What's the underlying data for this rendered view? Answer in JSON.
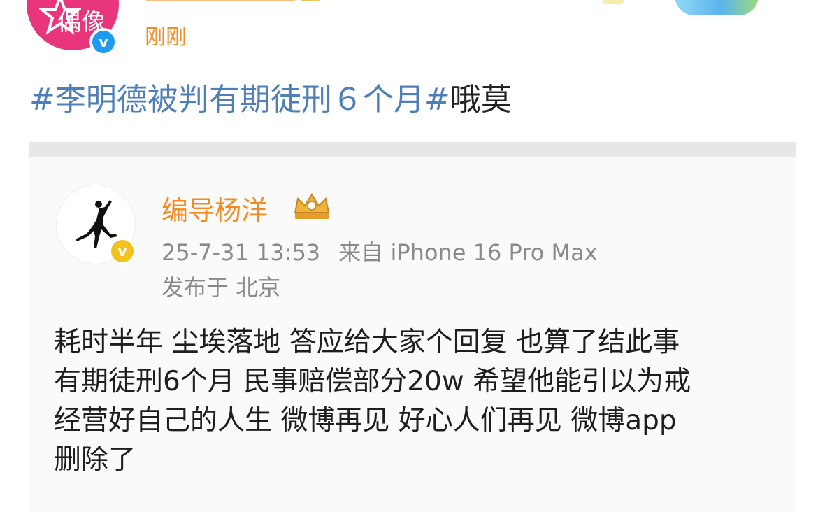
{
  "post": {
    "avatar_text": "偶像",
    "verified_badge": "v",
    "time": "刚刚",
    "topic": "#李明德被判有期徒刑６个月#",
    "text_after": "哦莫"
  },
  "quoted_post": {
    "author": "编导杨洋",
    "verified_badge": "v",
    "date": "25-7-31 13:53",
    "source": "来自 iPhone 16 Pro Max",
    "location": "发布于 北京",
    "body_lines": [
      "耗时半年 尘埃落地 答应给大家个回复 也算了结此事",
      "有期徒刑6个月 民事赔偿部分20w 希望他能引以为戒",
      "经营好自己的人生 微博再见 好心人们再见 微博app",
      "删除了"
    ]
  },
  "colors": {
    "topic": "#4f7fb8",
    "username": "#f28a22",
    "timestamp": "#f28c28",
    "avatar_bg": "#e8357c",
    "verified_blue": "#1d9bf0",
    "verified_gold": "#f4c21d"
  },
  "icons": [
    "star-icon",
    "verified-icon",
    "crown-icon",
    "jumpman-logo-icon"
  ]
}
